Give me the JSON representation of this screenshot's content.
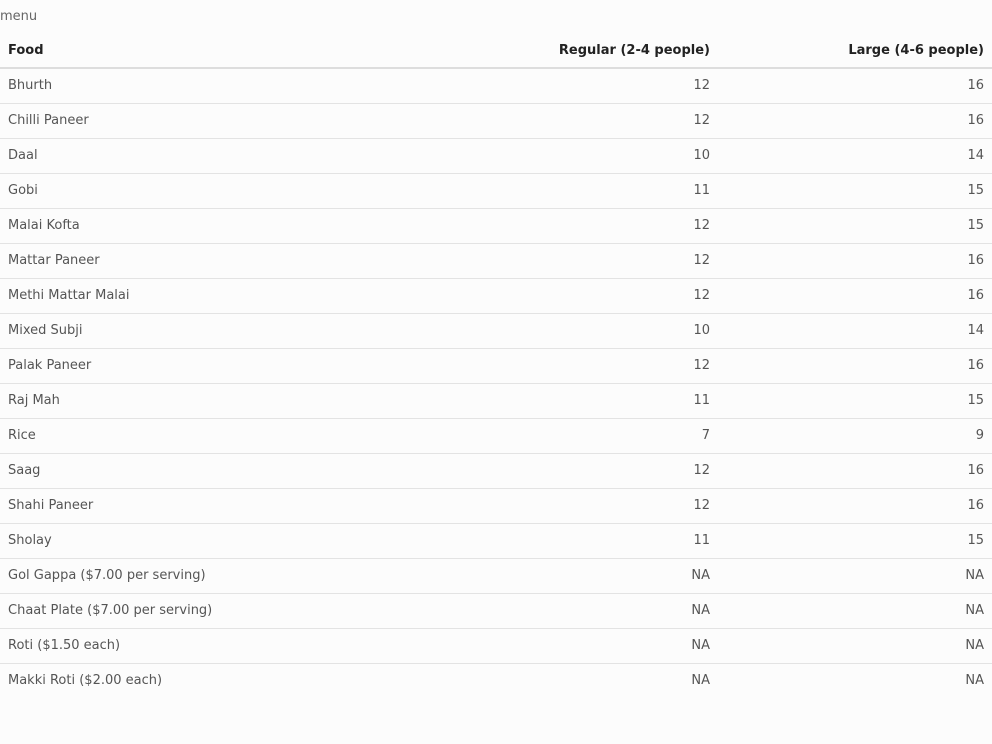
{
  "caption": "menu",
  "table": {
    "headers": {
      "food": "Food",
      "regular": "Regular (2-4 people)",
      "large": "Large (4-6 people)"
    },
    "rows": [
      {
        "food": "Bhurth",
        "regular": "12",
        "large": "16"
      },
      {
        "food": "Chilli Paneer",
        "regular": "12",
        "large": "16"
      },
      {
        "food": "Daal",
        "regular": "10",
        "large": "14"
      },
      {
        "food": "Gobi",
        "regular": "11",
        "large": "15"
      },
      {
        "food": "Malai Kofta",
        "regular": "12",
        "large": "15"
      },
      {
        "food": "Mattar Paneer",
        "regular": "12",
        "large": "16"
      },
      {
        "food": "Methi Mattar Malai",
        "regular": "12",
        "large": "16"
      },
      {
        "food": "Mixed Subji",
        "regular": "10",
        "large": "14"
      },
      {
        "food": "Palak Paneer",
        "regular": "12",
        "large": "16"
      },
      {
        "food": "Raj Mah",
        "regular": "11",
        "large": "15"
      },
      {
        "food": "Rice",
        "regular": "7",
        "large": "9"
      },
      {
        "food": "Saag",
        "regular": "12",
        "large": "16"
      },
      {
        "food": "Shahi Paneer",
        "regular": "12",
        "large": "16"
      },
      {
        "food": "Sholay",
        "regular": "11",
        "large": "15"
      },
      {
        "food": "Gol Gappa ($7.00 per serving)",
        "regular": "NA",
        "large": "NA"
      },
      {
        "food": "Chaat Plate ($7.00 per serving)",
        "regular": "NA",
        "large": "NA"
      },
      {
        "food": "Roti ($1.50 each)",
        "regular": "NA",
        "large": "NA"
      },
      {
        "food": "Makki Roti ($2.00 each)",
        "regular": "NA",
        "large": "NA"
      }
    ]
  }
}
